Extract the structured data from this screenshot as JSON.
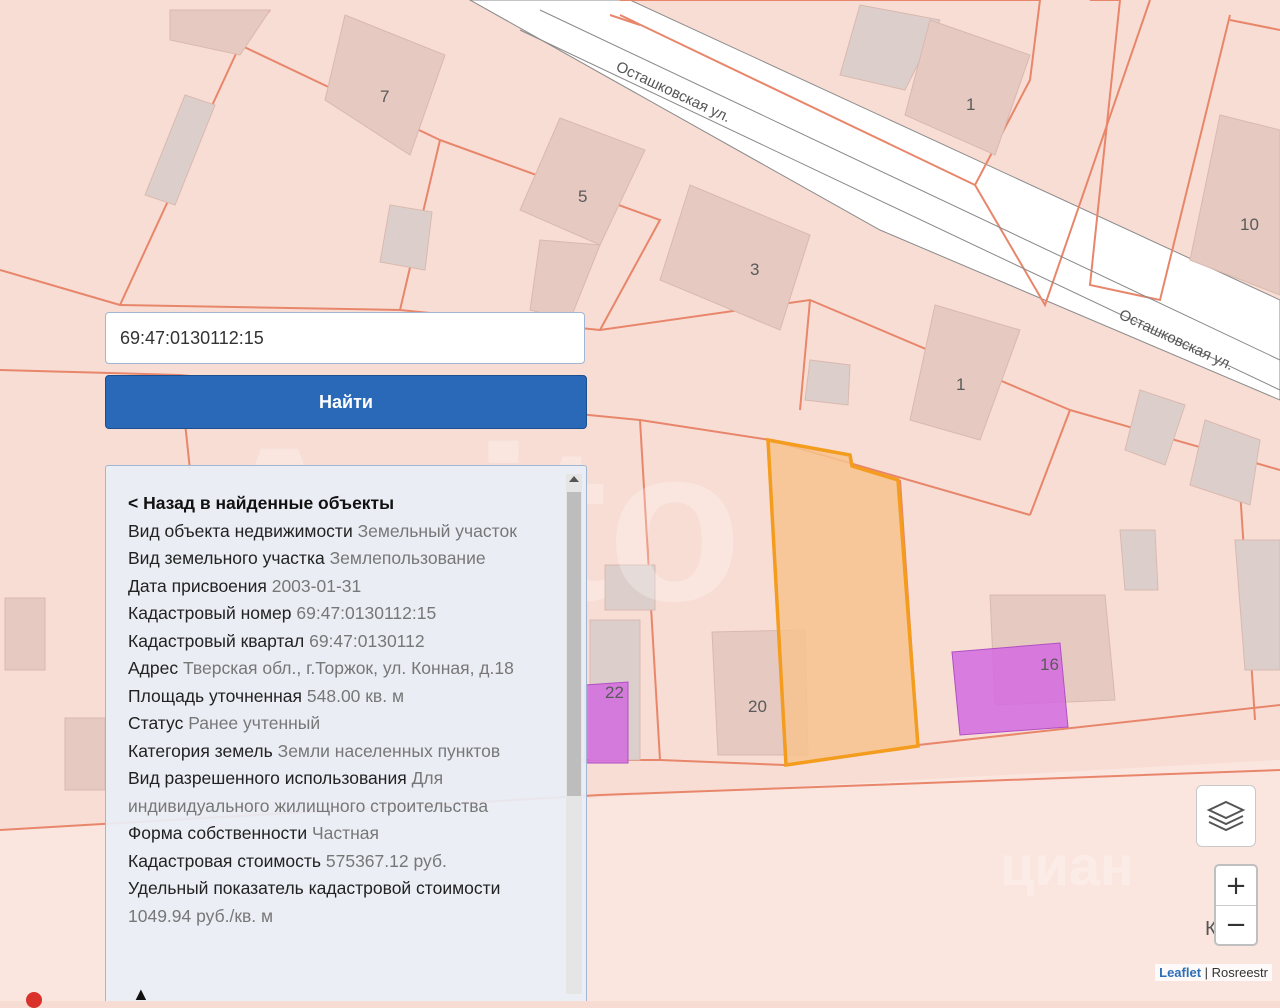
{
  "map": {
    "streets": [
      "Осташковская ул.",
      "Осташковская ул.",
      "Кон"
    ],
    "house_numbers": [
      "7",
      "1",
      "5",
      "3",
      "10",
      "1",
      "22",
      "20",
      "16"
    ],
    "colors": {
      "parcel_fill": "#f9dfd5",
      "parcel_stroke": "#e8866b",
      "highlight": "#f39c1e",
      "magenta": "#d46be0"
    }
  },
  "search": {
    "value": "69:47:0130112:15",
    "button": "Найти"
  },
  "panel": {
    "back": "< Назад в найденные объекты",
    "rows": [
      {
        "k": "Вид объекта недвижимости",
        "v": "Земельный участок"
      },
      {
        "k": "Вид земельного участка",
        "v": "Землепользование"
      },
      {
        "k": "Дата присвоения",
        "v": "2003-01-31"
      },
      {
        "k": "Кадастровый номер",
        "v": "69:47:0130112:15"
      },
      {
        "k": "Кадастровый квартал",
        "v": "69:47:0130112"
      },
      {
        "k": "Адрес",
        "v": "Тверская обл., г.Торжок, ул. Конная, д.18"
      },
      {
        "k": "Площадь уточненная",
        "v": "548.00 кв. м"
      },
      {
        "k": "Статус",
        "v": "Ранее учтенный"
      },
      {
        "k": "Категория земель",
        "v": "Земли населенных пунктов"
      },
      {
        "k": "Вид разрешенного использования",
        "v": "Для индивидуального жилищного строительства"
      },
      {
        "k": "Форма собственности",
        "v": "Частная"
      },
      {
        "k": "Кадастровая стоимость",
        "v": "575367.12 руб."
      },
      {
        "k": "Удельный показатель кадастровой стоимости",
        "v": "1049.94 руб./кв. м"
      }
    ],
    "footer_glyph": "▲"
  },
  "controls": {
    "zoom_in": "+",
    "zoom_out": "−",
    "layers_icon": "layers-icon"
  },
  "attribution": {
    "leaflet": "Leaflet",
    "sep": " | ",
    "source": "Rosreestr"
  },
  "watermarks": {
    "avito": "Avito",
    "cian": "циан"
  }
}
